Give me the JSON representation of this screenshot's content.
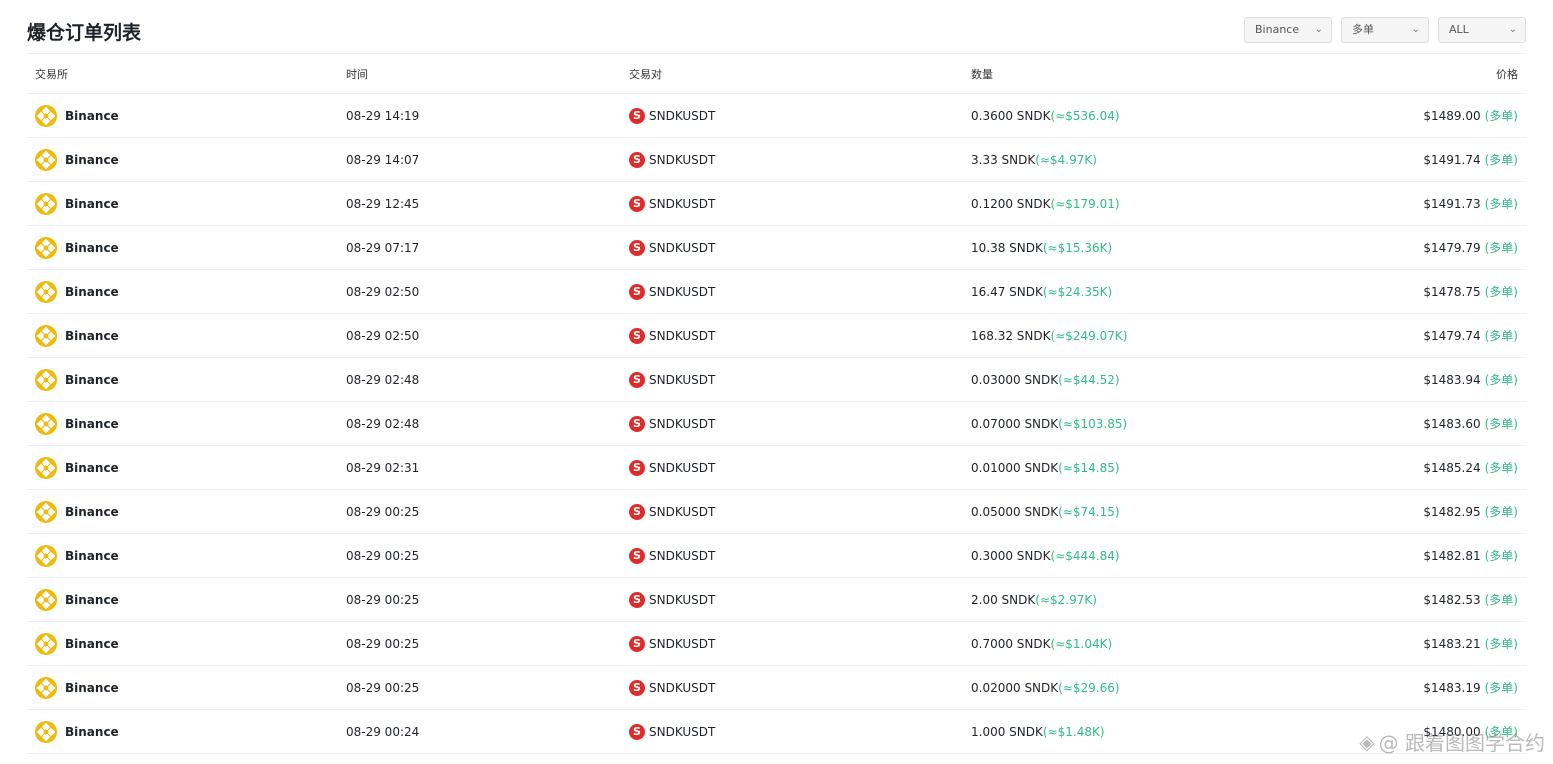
{
  "page": {
    "title": "爆仓订单列表",
    "filters": [
      {
        "name": "exchange",
        "value": "Binance"
      },
      {
        "name": "side",
        "value": "多单"
      },
      {
        "name": "symbol",
        "value": "ALL"
      }
    ]
  },
  "table": {
    "headers": [
      "交易所",
      "时间",
      "交易对",
      "数量",
      "价格"
    ],
    "rows": [
      {
        "exchange": "Binance",
        "time": "08-29 14:19",
        "pair": "SNDKUSDT",
        "qty": "0.3600 SNDK",
        "usd": "(≈$536.04)",
        "price": "$1489.00",
        "side": "(多单)"
      },
      {
        "exchange": "Binance",
        "time": "08-29 14:07",
        "pair": "SNDKUSDT",
        "qty": "3.33 SNDK",
        "usd": "(≈$4.97K)",
        "price": "$1491.74",
        "side": "(多单)"
      },
      {
        "exchange": "Binance",
        "time": "08-29 12:45",
        "pair": "SNDKUSDT",
        "qty": "0.1200 SNDK",
        "usd": "(≈$179.01)",
        "price": "$1491.73",
        "side": "(多单)"
      },
      {
        "exchange": "Binance",
        "time": "08-29 07:17",
        "pair": "SNDKUSDT",
        "qty": "10.38 SNDK",
        "usd": "(≈$15.36K)",
        "price": "$1479.79",
        "side": "(多单)"
      },
      {
        "exchange": "Binance",
        "time": "08-29 02:50",
        "pair": "SNDKUSDT",
        "qty": "16.47 SNDK",
        "usd": "(≈$24.35K)",
        "price": "$1478.75",
        "side": "(多单)"
      },
      {
        "exchange": "Binance",
        "time": "08-29 02:50",
        "pair": "SNDKUSDT",
        "qty": "168.32 SNDK",
        "usd": "(≈$249.07K)",
        "price": "$1479.74",
        "side": "(多单)"
      },
      {
        "exchange": "Binance",
        "time": "08-29 02:48",
        "pair": "SNDKUSDT",
        "qty": "0.03000 SNDK",
        "usd": "(≈$44.52)",
        "price": "$1483.94",
        "side": "(多单)"
      },
      {
        "exchange": "Binance",
        "time": "08-29 02:48",
        "pair": "SNDKUSDT",
        "qty": "0.07000 SNDK",
        "usd": "(≈$103.85)",
        "price": "$1483.60",
        "side": "(多单)"
      },
      {
        "exchange": "Binance",
        "time": "08-29 02:31",
        "pair": "SNDKUSDT",
        "qty": "0.01000 SNDK",
        "usd": "(≈$14.85)",
        "price": "$1485.24",
        "side": "(多单)"
      },
      {
        "exchange": "Binance",
        "time": "08-29 00:25",
        "pair": "SNDKUSDT",
        "qty": "0.05000 SNDK",
        "usd": "(≈$74.15)",
        "price": "$1482.95",
        "side": "(多单)"
      },
      {
        "exchange": "Binance",
        "time": "08-29 00:25",
        "pair": "SNDKUSDT",
        "qty": "0.3000 SNDK",
        "usd": "(≈$444.84)",
        "price": "$1482.81",
        "side": "(多单)"
      },
      {
        "exchange": "Binance",
        "time": "08-29 00:25",
        "pair": "SNDKUSDT",
        "qty": "2.00 SNDK",
        "usd": "(≈$2.97K)",
        "price": "$1482.53",
        "side": "(多单)"
      },
      {
        "exchange": "Binance",
        "time": "08-29 00:25",
        "pair": "SNDKUSDT",
        "qty": "0.7000 SNDK",
        "usd": "(≈$1.04K)",
        "price": "$1483.21",
        "side": "(多单)"
      },
      {
        "exchange": "Binance",
        "time": "08-29 00:25",
        "pair": "SNDKUSDT",
        "qty": "0.02000 SNDK",
        "usd": "(≈$29.66)",
        "price": "$1483.19",
        "side": "(多单)"
      },
      {
        "exchange": "Binance",
        "time": "08-29 00:24",
        "pair": "SNDKUSDT",
        "qty": "1.000 SNDK",
        "usd": "(≈$1.48K)",
        "price": "$1480.00",
        "side": "(多单)"
      }
    ]
  },
  "icons": {
    "exchange": "binance-logo-icon",
    "pair": "sndk-token-icon",
    "pair_glyph": "S",
    "chevron": "chevron-down-icon",
    "chevron_glyph": "⌄"
  },
  "watermark": {
    "glyph": "◈",
    "text": "@ 跟着图图学合约"
  },
  "colors": {
    "accent_green": "#2ebd85",
    "binance_yellow": "#f0b90b",
    "token_red": "#e02b2b"
  }
}
